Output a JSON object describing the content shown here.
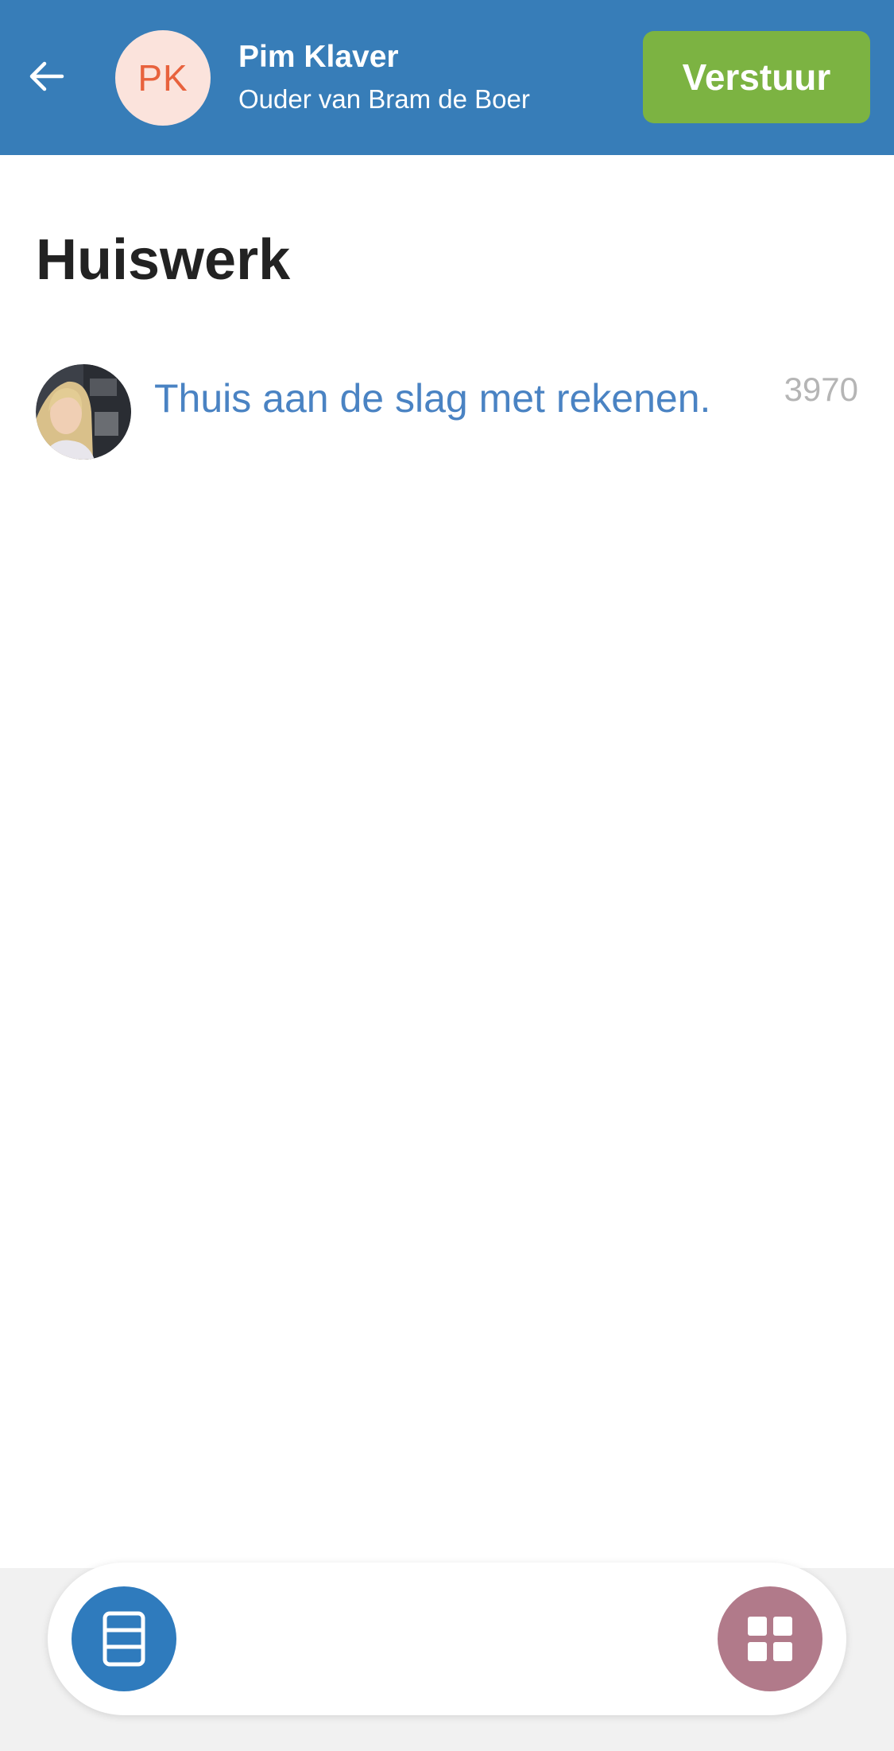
{
  "header": {
    "back_icon": "arrow-left-icon",
    "avatar_initials": "PK",
    "contact_name": "Pim Klaver",
    "contact_subtitle": "Ouder van Bram de Boer",
    "send_label": "Verstuur",
    "colors": {
      "bar": "#377db8",
      "send_button": "#7cb342",
      "avatar_bg": "#fbe3dc",
      "avatar_text": "#e8623d"
    }
  },
  "main": {
    "title": "Huiswerk",
    "items": [
      {
        "text": "Thuis aan de slag met rekenen.",
        "count": "3970"
      }
    ]
  },
  "footer": {
    "left_button_icon": "document-list-icon",
    "right_button_icon": "grid-icon",
    "colors": {
      "left_button": "#2f7bbd",
      "right_button": "#b17a8a"
    }
  }
}
